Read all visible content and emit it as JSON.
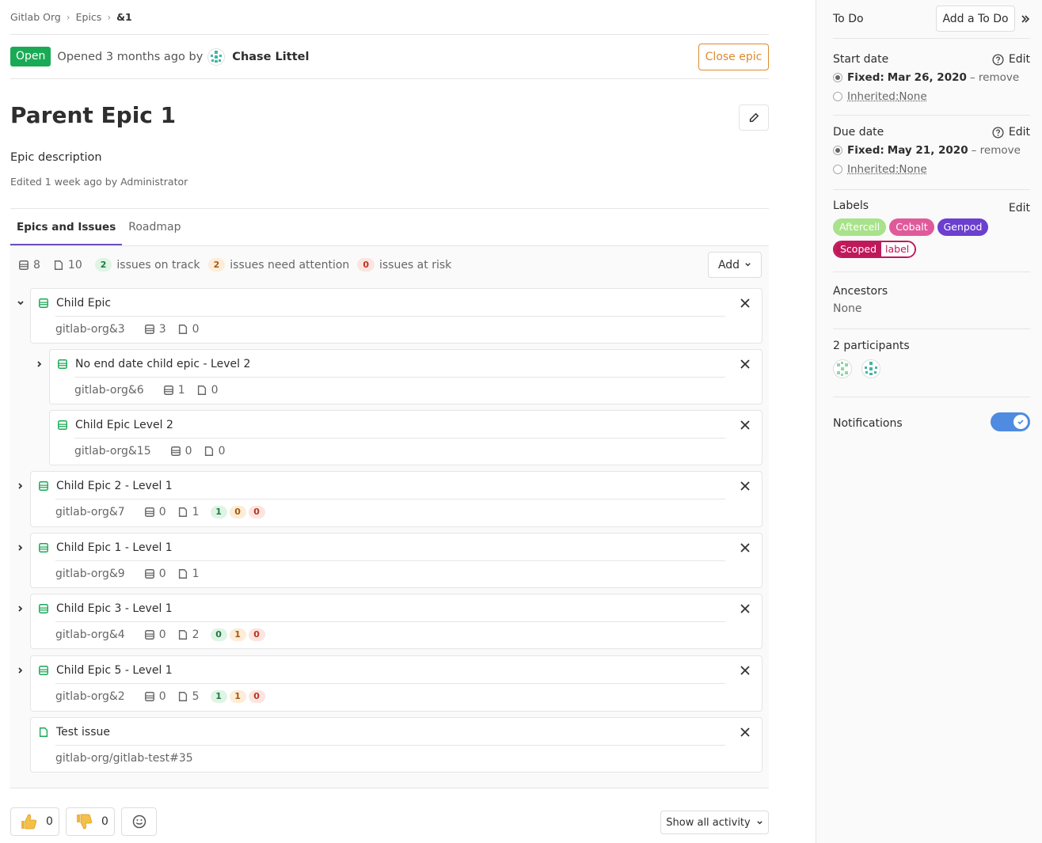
{
  "breadcrumb": {
    "group": "Gitlab Org",
    "section": "Epics",
    "current": "&1"
  },
  "status": {
    "badge": "Open",
    "opened_text": "Opened 3 months ago by",
    "author": "Chase Littel",
    "close_button": "Close epic"
  },
  "epic": {
    "title": "Parent Epic 1",
    "description": "Epic description",
    "edited": "Edited 1 week ago by Administrator"
  },
  "tabs": [
    "Epics and Issues",
    "Roadmap"
  ],
  "tree_header": {
    "epic_count": "8",
    "issue_count": "10",
    "on_track_count": "2",
    "on_track_label": "issues on track",
    "attention_count": "2",
    "attention_label": "issues need attention",
    "at_risk_count": "0",
    "at_risk_label": "issues at risk",
    "add_button": "Add"
  },
  "items": [
    {
      "title": "Child Epic",
      "ref": "gitlab-org&3",
      "epics": "3",
      "issues": "0"
    },
    {
      "title": "No end date child epic - Level 2",
      "ref": "gitlab-org&6",
      "epics": "1",
      "issues": "0"
    },
    {
      "title": "Child Epic Level 2",
      "ref": "gitlab-org&15",
      "epics": "0",
      "issues": "0"
    },
    {
      "title": "Child Epic 2 - Level 1",
      "ref": "gitlab-org&7",
      "epics": "0",
      "issues": "1",
      "health": [
        "1",
        "0",
        "0"
      ]
    },
    {
      "title": "Child Epic 1 - Level 1",
      "ref": "gitlab-org&9",
      "epics": "0",
      "issues": "1"
    },
    {
      "title": "Child Epic 3 - Level 1",
      "ref": "gitlab-org&4",
      "epics": "0",
      "issues": "2",
      "health": [
        "0",
        "1",
        "0"
      ]
    },
    {
      "title": "Child Epic 5 - Level 1",
      "ref": "gitlab-org&2",
      "epics": "0",
      "issues": "5",
      "health": [
        "1",
        "1",
        "0"
      ]
    },
    {
      "title": "Test issue",
      "ref": "gitlab-org/gitlab-test#35"
    }
  ],
  "awards": {
    "thumbsup": "0",
    "thumbsdown": "0"
  },
  "show_activity": "Show all activity",
  "sidebar": {
    "todo_label": "To Do",
    "todo_button": "Add a To Do",
    "start_date": {
      "title": "Start date",
      "edit": "Edit",
      "fixed_label": "Fixed:",
      "fixed_value": "Mar 26, 2020",
      "remove": "– remove",
      "inherited": "Inherited:",
      "inherited_value": "None"
    },
    "due_date": {
      "title": "Due date",
      "edit": "Edit",
      "fixed_label": "Fixed:",
      "fixed_value": "May 21, 2020",
      "remove": "– remove",
      "inherited": "Inherited:",
      "inherited_value": "None"
    },
    "labels": {
      "title": "Labels",
      "edit": "Edit",
      "items": [
        {
          "name": "Aftercell",
          "color": "#a8e28a"
        },
        {
          "name": "Cobalt",
          "color": "#e05a9a"
        },
        {
          "name": "Genpod",
          "color": "#6b3fcf"
        }
      ],
      "scoped_key": "Scoped",
      "scoped_value": "label"
    },
    "ancestors": {
      "title": "Ancestors",
      "value": "None"
    },
    "participants": "2 participants",
    "notifications": "Notifications"
  },
  "colors": {
    "open": "#1aaa55",
    "close_epic": "#db8a30",
    "active_tab": "#6b4fbb",
    "toggle": "#4f8be0",
    "epic_icon": "#1aaa55"
  }
}
